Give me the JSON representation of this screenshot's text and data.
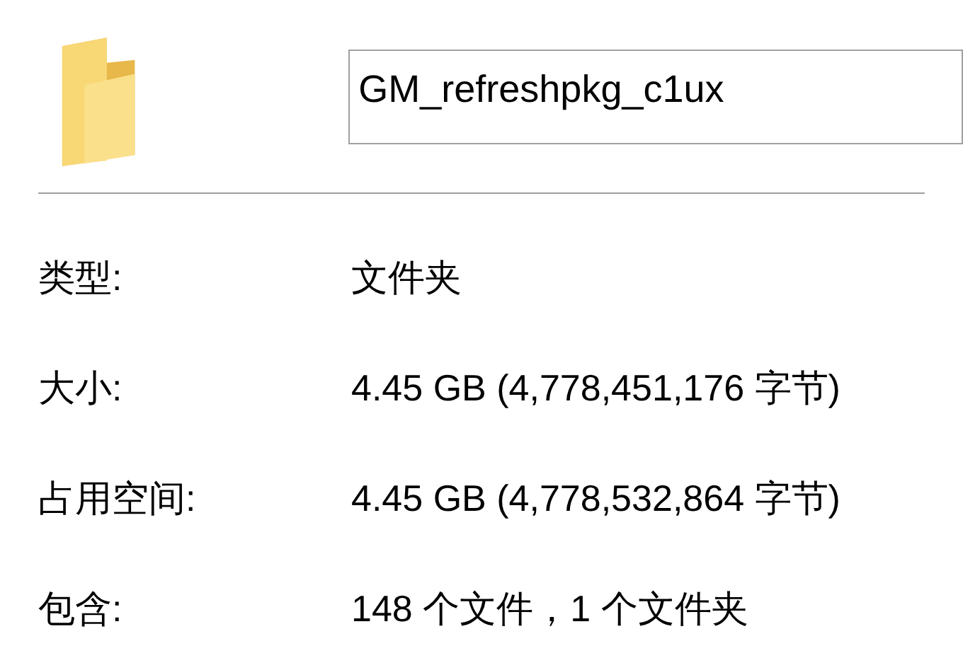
{
  "name_field": {
    "value": "GM_refreshpkg_c1ux"
  },
  "properties": [
    {
      "label": "类型:",
      "value": "文件夹"
    },
    {
      "label": "大小:",
      "value": "4.45 GB (4,778,451,176 字节)"
    },
    {
      "label": "占用空间:",
      "value": "4.45 GB (4,778,532,864 字节)"
    },
    {
      "label": "包含:",
      "value": "148 个文件，1 个文件夹"
    }
  ]
}
